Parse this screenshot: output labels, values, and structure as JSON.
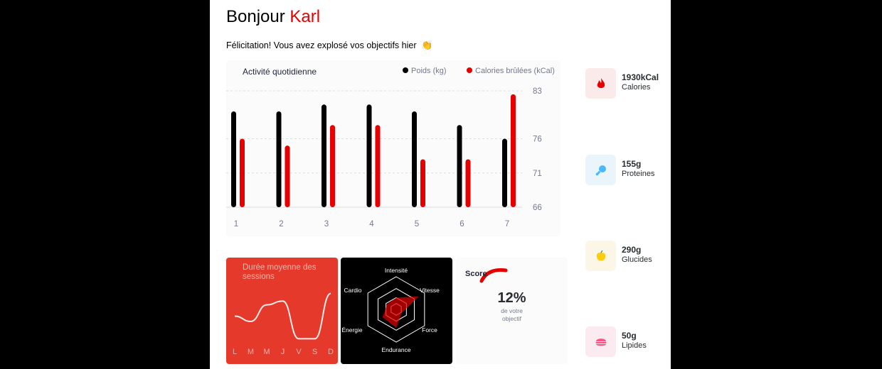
{
  "header": {
    "greeting": "Bonjour",
    "user_name": "Karl",
    "message": "Félicitation! Vous avez explosé vos objectifs hier",
    "message_icon": "👏"
  },
  "activity": {
    "title": "Activité quotidienne",
    "legend_weight": "Poids (kg)",
    "legend_calories": "Calories brûlées (kCal)",
    "colors": {
      "weight": "#000000",
      "calories": "#e60000"
    },
    "y_ticks": [
      "83",
      "76",
      "71",
      "66"
    ]
  },
  "chart_data": [
    {
      "type": "bar",
      "title": "Activité quotidienne",
      "categories": [
        "1",
        "2",
        "3",
        "4",
        "5",
        "6",
        "7"
      ],
      "series": [
        {
          "name": "Poids (kg)",
          "values": [
            80,
            80,
            81,
            81,
            80,
            78,
            76
          ]
        },
        {
          "name": "Calories brûlées (kCal)",
          "values": [
            76,
            75,
            78,
            78,
            73,
            73,
            82.5
          ]
        }
      ],
      "y_right_ticks": [
        83,
        76,
        71,
        66
      ],
      "ylim": [
        66,
        83
      ],
      "grid": "horizontal dashed"
    },
    {
      "type": "line",
      "title": "Durée moyenne des sessions",
      "categories": [
        "L",
        "M",
        "M",
        "J",
        "V",
        "S",
        "D"
      ],
      "values": [
        30,
        23,
        45,
        50,
        0,
        0,
        60
      ],
      "ylim": [
        -10,
        70
      ]
    },
    {
      "type": "radar",
      "axes": [
        "Intensité",
        "Vitesse",
        "Force",
        "Endurance",
        "Énergie",
        "Cardio"
      ],
      "values": [
        90,
        200,
        50,
        140,
        120,
        80
      ],
      "max": 250
    }
  ],
  "sessions": {
    "title": "Durée moyenne des sessions",
    "days": [
      "L",
      "M",
      "M",
      "J",
      "V",
      "S",
      "D"
    ]
  },
  "performance": {
    "labels": [
      "Intensité",
      "Vitesse",
      "Force",
      "Endurance",
      "Énergie",
      "Cardio"
    ]
  },
  "score": {
    "title": "Score",
    "value": "12%",
    "label_line1": "de votre",
    "label_line2": "objectif",
    "fraction": 0.12,
    "color": "#e60000"
  },
  "kpis": [
    {
      "value": "1930kCal",
      "label": "Calories",
      "icon": "flame-icon",
      "bg": "#fbeaea",
      "fg": "#e60000"
    },
    {
      "value": "155g",
      "label": "Proteines",
      "icon": "chicken-icon",
      "bg": "#e9f4fb",
      "fg": "#4ab8ff"
    },
    {
      "value": "290g",
      "label": "Glucides",
      "icon": "apple-icon",
      "bg": "#fbf6e5",
      "fg": "#fdcc0c"
    },
    {
      "value": "50g",
      "label": "Lipides",
      "icon": "burger-icon",
      "bg": "#fbeaef",
      "fg": "#fd5181"
    }
  ]
}
